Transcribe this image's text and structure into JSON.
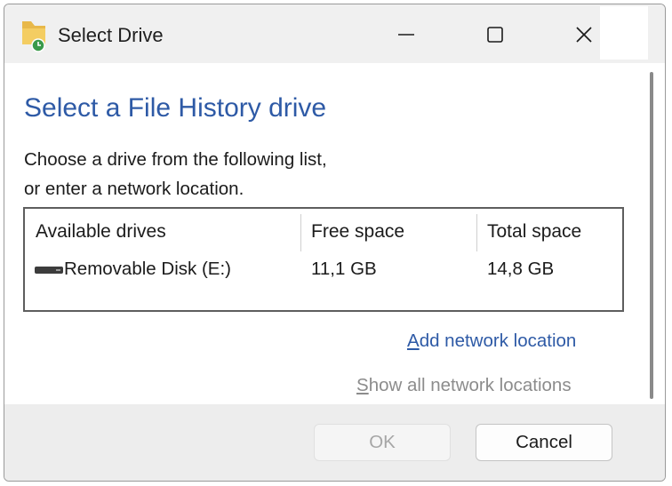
{
  "window": {
    "title": "Select Drive",
    "controls": {
      "minimize": "minimize",
      "maximize": "maximize",
      "close": "close"
    },
    "icon": "file-history-drive-icon"
  },
  "content": {
    "heading": "Select a File History drive",
    "description_line1": "Choose a drive from the following list,",
    "description_line2": "or enter a network location.",
    "table": {
      "columns": [
        "Available drives",
        "Free space",
        "Total space"
      ],
      "rows": [
        {
          "icon": "removable-disk-icon",
          "name": "Removable Disk (E:)",
          "free": "11,1 GB",
          "total": "14,8 GB"
        }
      ]
    },
    "add_network": {
      "accel": "A",
      "rest": "dd network location"
    },
    "show_all": {
      "accel": "S",
      "rest": "how all network locations"
    }
  },
  "footer": {
    "ok_label": "OK",
    "ok_enabled": false,
    "cancel_label": "Cancel"
  },
  "colors": {
    "heading": "#2e5aa6",
    "link": "#2e5aa6",
    "link_disabled": "#8c8c8c",
    "titlebar": "#f0f0f0",
    "footer": "#ededed"
  }
}
